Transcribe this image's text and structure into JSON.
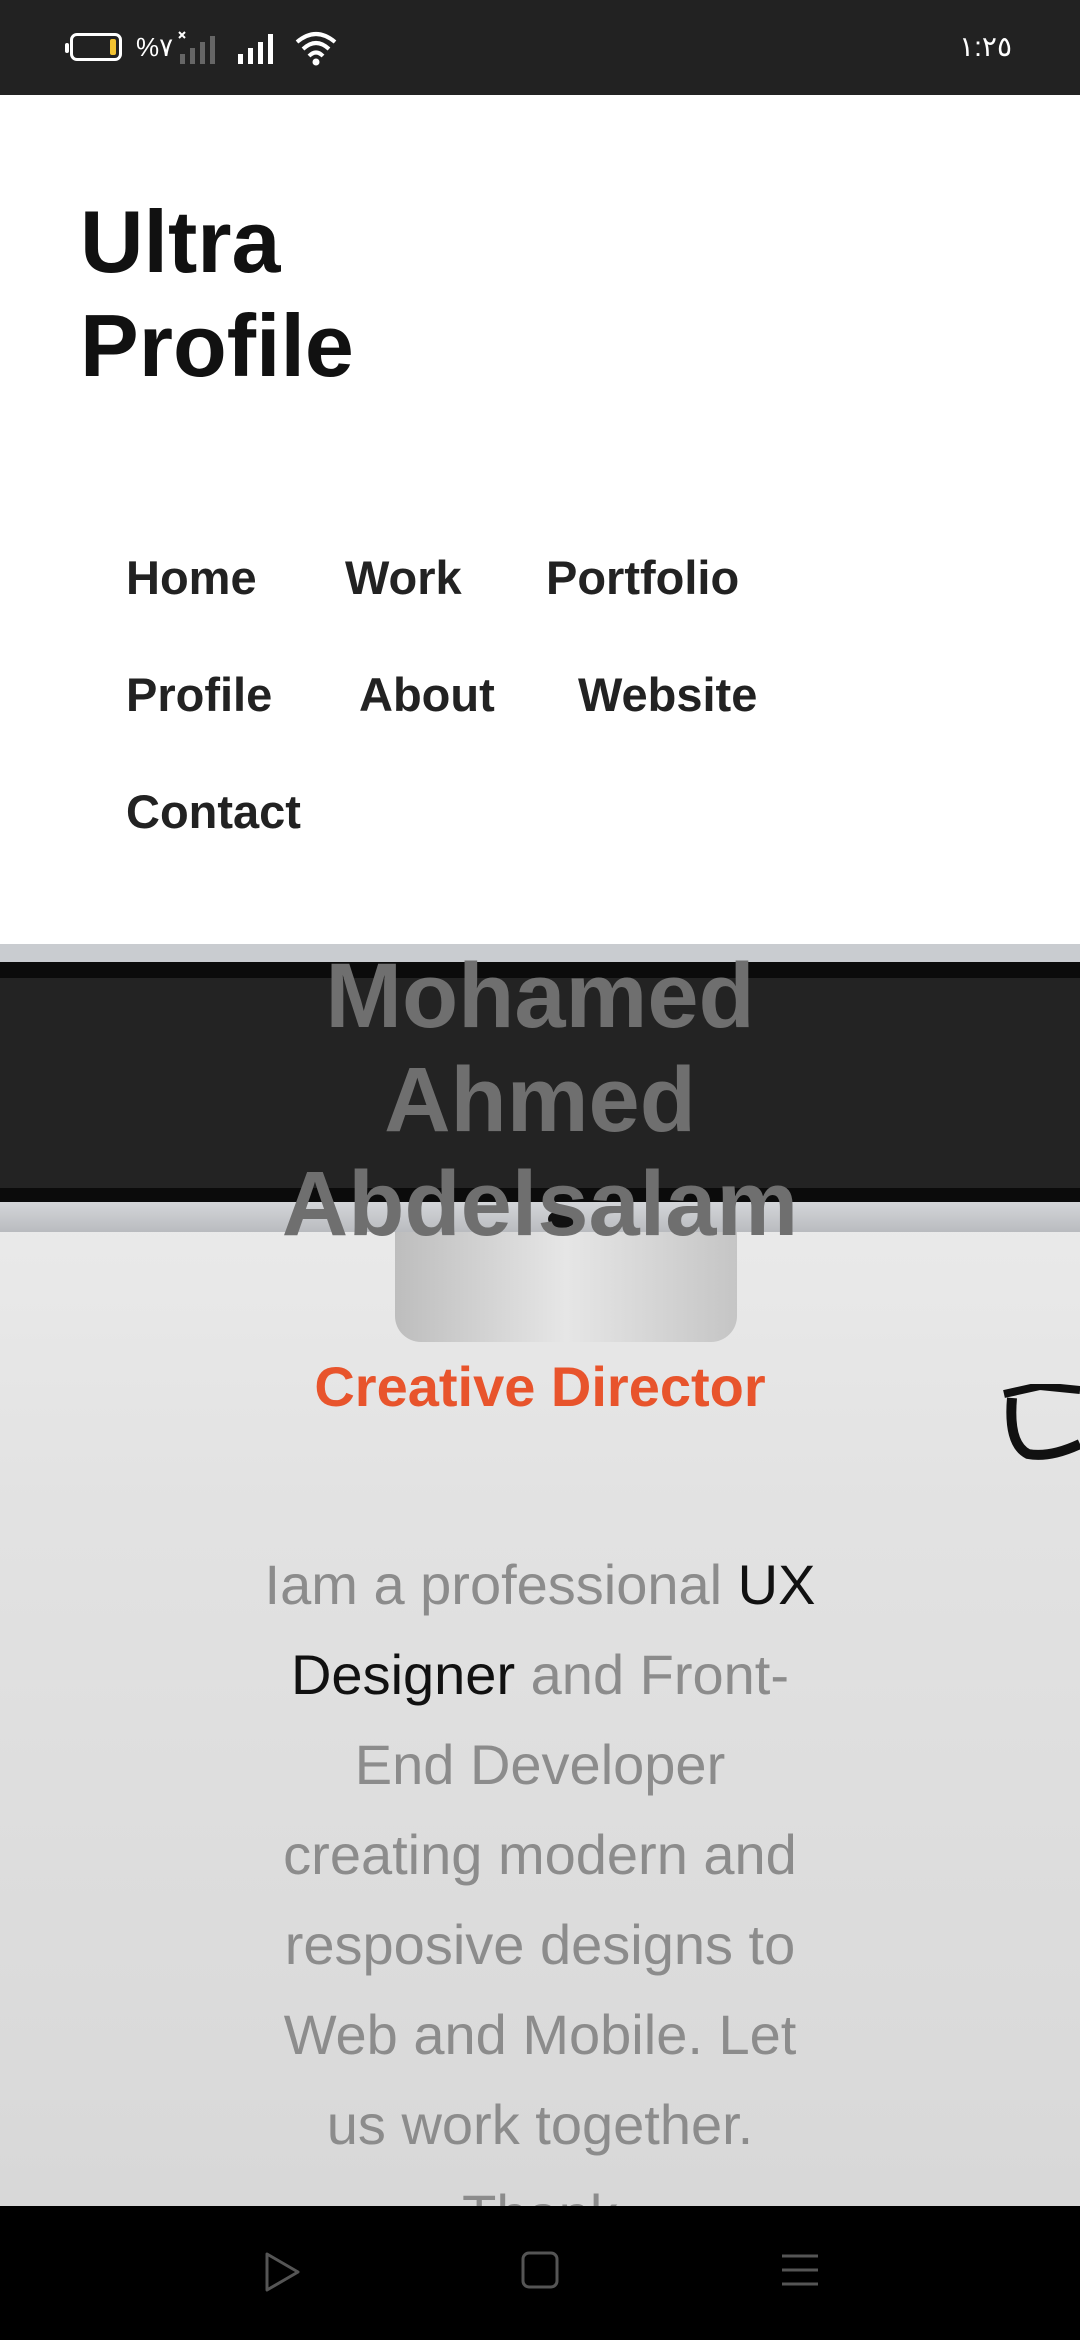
{
  "status_bar": {
    "battery_text": "%٧",
    "time": "١:٢٥"
  },
  "header": {
    "brand_line1": "Ultra",
    "brand_line2": "Profile"
  },
  "nav": {
    "items": [
      {
        "label": "Home"
      },
      {
        "label": "Work"
      },
      {
        "label": "Portfolio"
      },
      {
        "label": "Profile"
      },
      {
        "label": "About"
      },
      {
        "label": "Website"
      },
      {
        "label": "Contact"
      }
    ]
  },
  "hero": {
    "name_line1": "Mohamed",
    "name_line2": "Ahmed",
    "name_line3": "Abdelsalam",
    "role": "Creative Director",
    "intro_before": "Iam a professional ",
    "intro_highlight": "UX Designer",
    "intro_after": " and Front-End Developer creating modern and resposive designs to Web and Mobile. Let us work together. Thank"
  },
  "colors": {
    "accent": "#e8542c",
    "name_text": "#6f6f6f",
    "body_text": "#8c8c8c",
    "status_bar": "#222222",
    "nav_bar": "#000000"
  },
  "icons": {
    "nav_back": "triangle-play-icon",
    "nav_home": "square-icon",
    "nav_menu": "hamburger-icon"
  }
}
